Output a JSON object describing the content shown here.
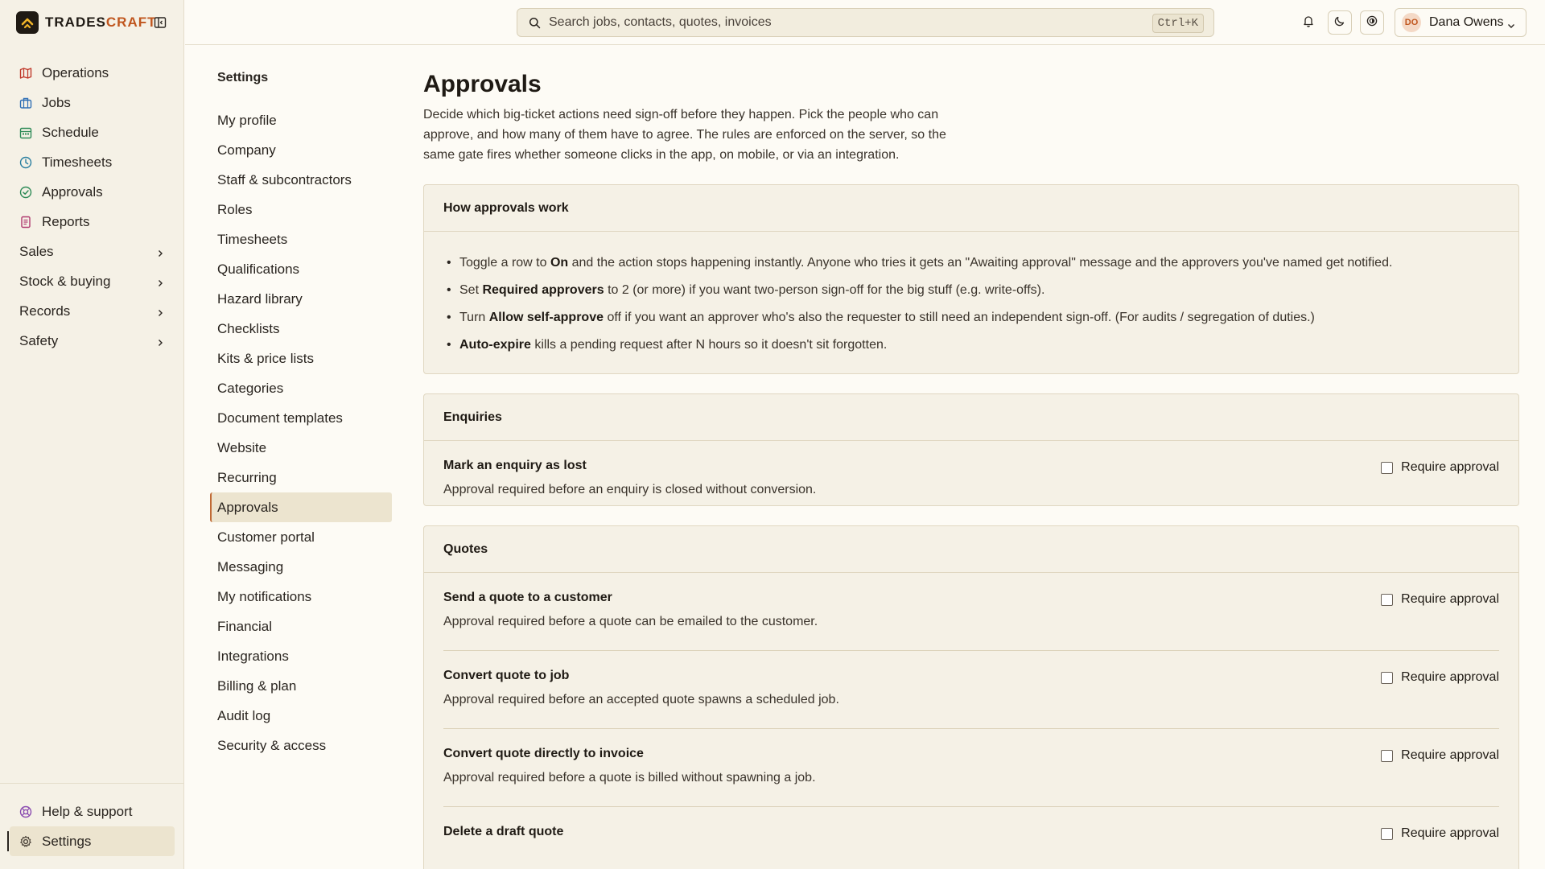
{
  "brand": {
    "name_dark": "TRADES",
    "name_accent": "CRAFT"
  },
  "sidebar": {
    "items": [
      {
        "label": "Operations",
        "icon": "map-icon",
        "color": "#c0392b"
      },
      {
        "label": "Jobs",
        "icon": "briefcase-icon",
        "color": "#2f6fb5"
      },
      {
        "label": "Schedule",
        "icon": "calendar-icon",
        "color": "#2e8b57"
      },
      {
        "label": "Timesheets",
        "icon": "clock-icon",
        "color": "#2a7fa0"
      },
      {
        "label": "Approvals",
        "icon": "check-circle-icon",
        "color": "#2e8b57"
      },
      {
        "label": "Reports",
        "icon": "document-icon",
        "color": "#b03a6f"
      }
    ],
    "groups": [
      "Sales",
      "Stock & buying",
      "Records",
      "Safety"
    ],
    "bottom": [
      {
        "label": "Help & support",
        "icon": "lifebuoy-icon"
      },
      {
        "label": "Settings",
        "icon": "gear-icon"
      }
    ]
  },
  "topbar": {
    "search_placeholder": "Search jobs, contacts, quotes, invoices",
    "shortcut": "Ctrl+K",
    "user": {
      "initials": "DO",
      "name": "Dana Owens"
    }
  },
  "settings_nav": {
    "title": "Settings",
    "items": [
      "My profile",
      "Company",
      "Staff & subcontractors",
      "Roles",
      "Timesheets",
      "Qualifications",
      "Hazard library",
      "Checklists",
      "Kits & price lists",
      "Categories",
      "Document templates",
      "Website",
      "Recurring",
      "Approvals",
      "Customer portal",
      "Messaging",
      "My notifications",
      "Financial",
      "Integrations",
      "Billing & plan",
      "Audit log",
      "Security & access"
    ],
    "active": "Approvals"
  },
  "main": {
    "title": "Approvals",
    "description": "Decide which big-ticket actions need sign-off before they happen. Pick the people who can approve, and how many of them have to agree. The rules are enforced on the server, so the same gate fires whether someone clicks in the app, on mobile, or via an integration.",
    "how": {
      "title": "How approvals work",
      "b1": {
        "t1": "Toggle a row to ",
        "bold": "On",
        "t2": " and the action stops happening instantly. Anyone who tries it gets an \"Awaiting approval\" message and the approvers you've named get notified."
      },
      "b2": {
        "t1": "Set ",
        "bold": "Required approvers",
        "t2": " to 2 (or more) if you want two-person sign-off for the big stuff (e.g. write-offs)."
      },
      "b3": {
        "t1": "Turn ",
        "bold": "Allow self-approve",
        "t2": " off if you want an approver who's also the requester to still need an independent sign-off. (For audits / segregation of duties.)"
      },
      "b4": {
        "bold": "Auto-expire",
        "t2": " kills a pending request after N hours so it doesn't sit forgotten."
      }
    },
    "require_label": "Require approval",
    "enquiries": {
      "title": "Enquiries",
      "rules": [
        {
          "title": "Mark an enquiry as lost",
          "desc": "Approval required before an enquiry is closed without conversion."
        }
      ]
    },
    "quotes": {
      "title": "Quotes",
      "rules": [
        {
          "title": "Send a quote to a customer",
          "desc": "Approval required before a quote can be emailed to the customer."
        },
        {
          "title": "Convert quote to job",
          "desc": "Approval required before an accepted quote spawns a scheduled job."
        },
        {
          "title": "Convert quote directly to invoice",
          "desc": "Approval required before a quote is billed without spawning a job."
        },
        {
          "title": "Delete a draft quote",
          "desc": ""
        }
      ]
    }
  }
}
